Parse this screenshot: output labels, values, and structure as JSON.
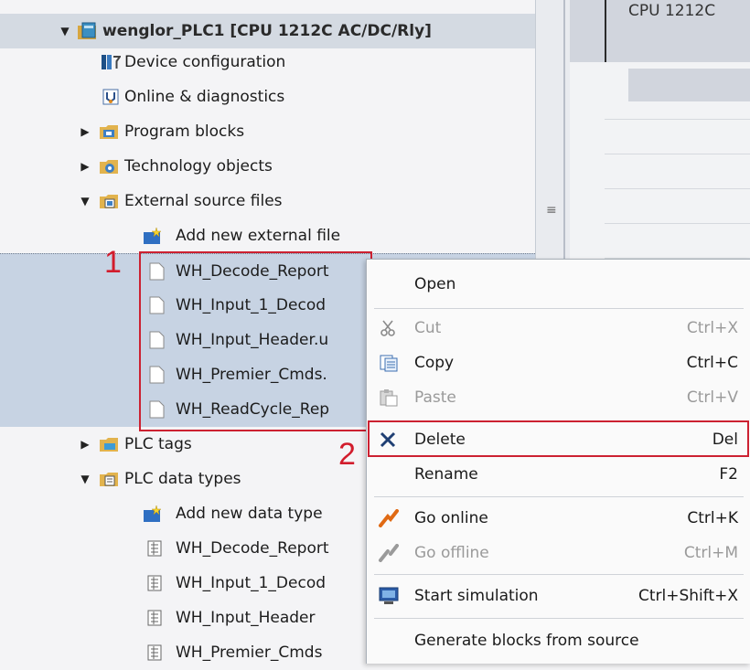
{
  "tree": {
    "project_node": "wenglor_PLC1 [CPU 1212C AC/DC/Rly]",
    "items": [
      {
        "label": "Device configuration",
        "icon": "device-config-icon"
      },
      {
        "label": "Online & diagnostics",
        "icon": "online-diagnostics-icon"
      },
      {
        "label": "Program blocks",
        "icon": "program-blocks-folder-icon"
      },
      {
        "label": "Technology objects",
        "icon": "technology-objects-folder-icon"
      },
      {
        "label": "External source files",
        "icon": "external-source-folder-icon"
      },
      {
        "label": "Add new external file",
        "icon": "add-new-icon"
      },
      {
        "label": "WH_Decode_Report",
        "icon": "file-icon"
      },
      {
        "label": "WH_Input_1_Decod",
        "icon": "file-icon"
      },
      {
        "label": "WH_Input_Header.u",
        "icon": "file-icon"
      },
      {
        "label": "WH_Premier_Cmds.",
        "icon": "file-icon"
      },
      {
        "label": "WH_ReadCycle_Rep",
        "icon": "file-icon"
      },
      {
        "label": "PLC tags",
        "icon": "plc-tags-folder-icon"
      },
      {
        "label": "PLC data types",
        "icon": "plc-data-types-folder-icon"
      },
      {
        "label": "Add new data type",
        "icon": "add-new-icon"
      },
      {
        "label": "WH_Decode_Report",
        "icon": "data-type-icon"
      },
      {
        "label": "WH_Input_1_Decod",
        "icon": "data-type-icon"
      },
      {
        "label": "WH_Input_Header",
        "icon": "data-type-icon"
      },
      {
        "label": "WH_Premier_Cmds",
        "icon": "data-type-icon"
      }
    ]
  },
  "right_pane": {
    "title": "CPU 1212C"
  },
  "annotations": {
    "marker_1": "1",
    "marker_2": "2",
    "accent": "#cc2131"
  },
  "context_menu": {
    "open": "Open",
    "cut": "Cut",
    "cut_shortcut": "Ctrl+X",
    "copy": "Copy",
    "copy_shortcut": "Ctrl+C",
    "paste": "Paste",
    "paste_shortcut": "Ctrl+V",
    "delete": "Delete",
    "delete_shortcut": "Del",
    "rename": "Rename",
    "rename_shortcut": "F2",
    "go_online": "Go online",
    "go_online_shortcut": "Ctrl+K",
    "go_offline": "Go offline",
    "go_offline_shortcut": "Ctrl+M",
    "start_simulation": "Start simulation",
    "start_simulation_shortcut": "Ctrl+Shift+X",
    "generate_blocks": "Generate blocks from source"
  }
}
